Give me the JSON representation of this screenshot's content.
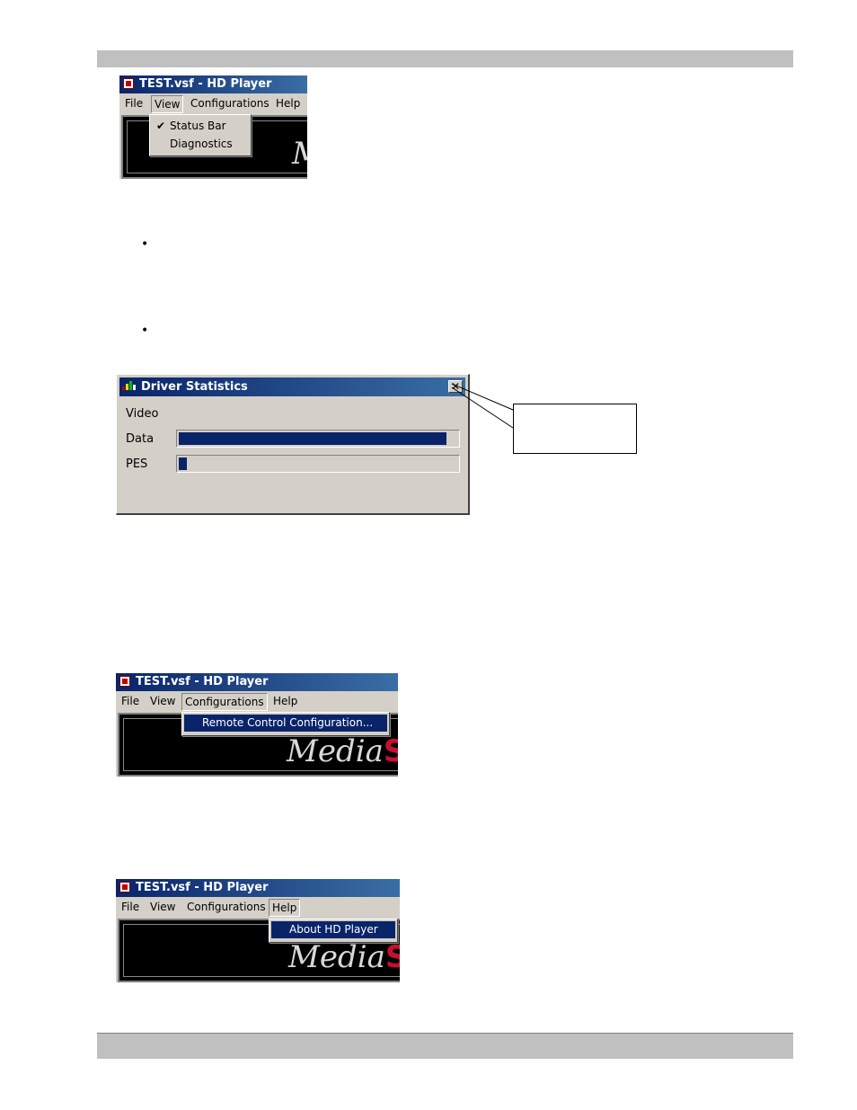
{
  "screens": [
    {
      "title": "TEST.vsf - HD Player",
      "menu": [
        "File",
        "View",
        "Configurations",
        "Help"
      ],
      "open_menu": "View",
      "dropdown": [
        {
          "label": "Status Bar",
          "checked": true
        },
        {
          "label": "Diagnostics",
          "checked": false
        }
      ],
      "logo_text": "M",
      "logo_accent": ""
    },
    {
      "title": "TEST.vsf - HD Player",
      "menu": [
        "File",
        "View",
        "Configurations",
        "Help"
      ],
      "open_menu": "Configurations",
      "dropdown": [
        {
          "label": "Remote Control Configuration...",
          "highlighted": true
        }
      ],
      "logo_text": "Media",
      "logo_accent": "S"
    },
    {
      "title": "TEST.vsf - HD Player",
      "menu": [
        "File",
        "View",
        "Configurations",
        "Help"
      ],
      "open_menu": "Help",
      "dropdown": [
        {
          "label": "About HD Player",
          "highlighted": true
        }
      ],
      "logo_text": "Media",
      "logo_accent": "S"
    }
  ],
  "bullets": [
    "•",
    "•"
  ],
  "driver_stats": {
    "title": "Driver Statistics",
    "close_glyph": "✕",
    "section": "Video",
    "rows": [
      {
        "label": "Data",
        "level": 0.96
      },
      {
        "label": "PES",
        "level": 0.03
      }
    ]
  },
  "colors": {
    "titlebar": "#0a246a",
    "progress": "#0a246a",
    "header_band": "#c0c0c0",
    "logo_accent": "#c8102e"
  }
}
